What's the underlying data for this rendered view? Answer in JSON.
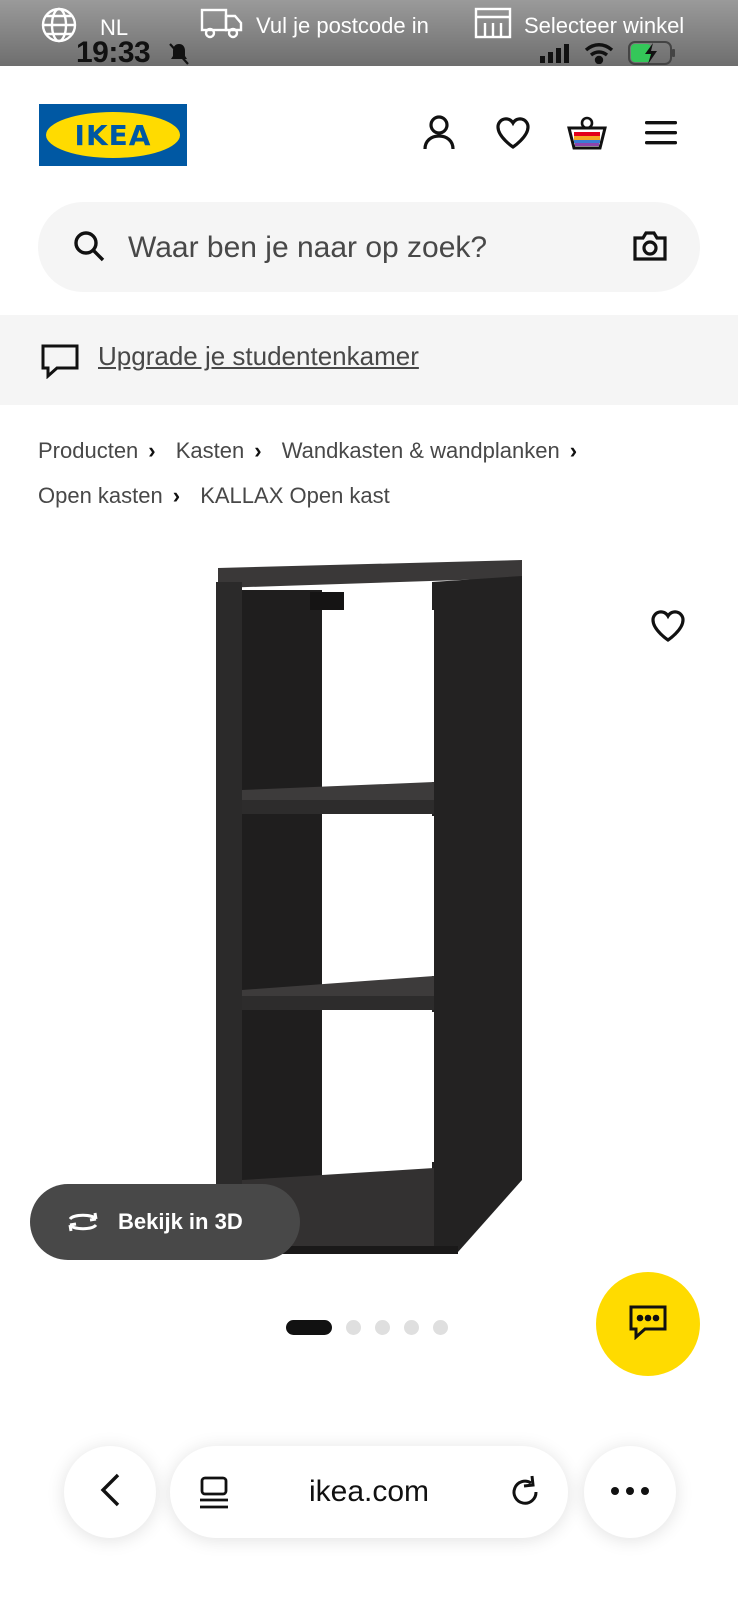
{
  "topbar": {
    "language": "NL",
    "postcode": "Vul je postcode in",
    "store": "Selecteer winkel",
    "time": "19:33"
  },
  "header": {
    "logo_text": "IKEA"
  },
  "search": {
    "placeholder": "Waar ben je naar op zoek?"
  },
  "banner": {
    "link_text": "Upgrade je studentenkamer"
  },
  "breadcrumb": [
    "Producten",
    "Kasten",
    "Wandkasten & wandplanken",
    "Open kasten",
    "KALLAX Open kast"
  ],
  "product": {
    "view_3d_label": "Bekijk in 3D",
    "image_count": 5,
    "active_image": 1
  },
  "browser": {
    "url": "ikea.com"
  },
  "colors": {
    "ikea_blue": "#0058a3",
    "ikea_yellow": "#ffdb00",
    "shelf": "#2b2a2a"
  }
}
